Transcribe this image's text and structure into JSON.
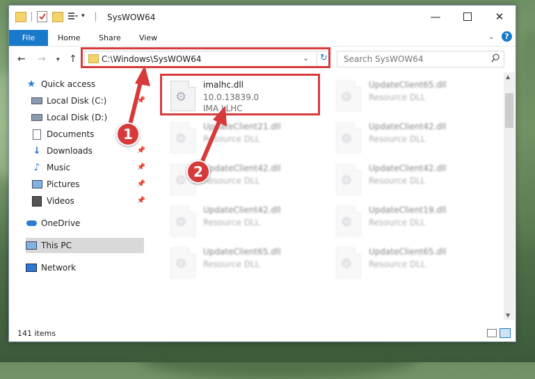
{
  "window": {
    "title": "SysWOW64",
    "minimize_icon": "minimize-icon",
    "maximize_icon": "maximize-icon",
    "close_icon": "close-icon"
  },
  "ribbon": {
    "tabs": [
      "File",
      "Home",
      "Share",
      "View"
    ]
  },
  "address": {
    "path": "C:\\Windows\\SysWOW64",
    "search_placeholder": "Search SysWOW64"
  },
  "nav": {
    "items": [
      {
        "label": "Quick access",
        "icon": "star-icon"
      },
      {
        "label": "Local Disk (C:)",
        "icon": "drive-icon"
      },
      {
        "label": "Local Disk (D:)",
        "icon": "drive-icon"
      },
      {
        "label": "Documents",
        "icon": "document-icon"
      },
      {
        "label": "Downloads",
        "icon": "download-icon"
      },
      {
        "label": "Music",
        "icon": "music-icon"
      },
      {
        "label": "Pictures",
        "icon": "pictures-icon"
      },
      {
        "label": "Videos",
        "icon": "video-icon"
      },
      {
        "label": "OneDrive",
        "icon": "cloud-icon"
      },
      {
        "label": "This PC",
        "icon": "computer-icon"
      },
      {
        "label": "Network",
        "icon": "network-icon"
      }
    ]
  },
  "files": [
    {
      "name": "imalhc.dll",
      "line2": "10.0.13839.0",
      "line3": "IMA LLHC"
    },
    {
      "name": "UpdateClient65.dll",
      "line2": "Resource DLL"
    },
    {
      "name": "UpdateClient21.dll",
      "line2": "Resource DLL"
    },
    {
      "name": "UpdateClient42.dll",
      "line2": "Resource DLL"
    },
    {
      "name": "UpdateClient42.dll",
      "line2": "Resource DLL"
    },
    {
      "name": "UpdateClient42.dll",
      "line2": "Resource DLL"
    },
    {
      "name": "UpdateClient42.dll",
      "line2": "Resource DLL"
    },
    {
      "name": "UpdateClient19.dll",
      "line2": "Resource DLL"
    },
    {
      "name": "UpdateClient65.dll",
      "line2": "Resource DLL"
    },
    {
      "name": "UpdateClient65.dll",
      "line2": "Resource DLL"
    }
  ],
  "status": {
    "count": "141 items"
  },
  "callouts": [
    "1",
    "2"
  ]
}
